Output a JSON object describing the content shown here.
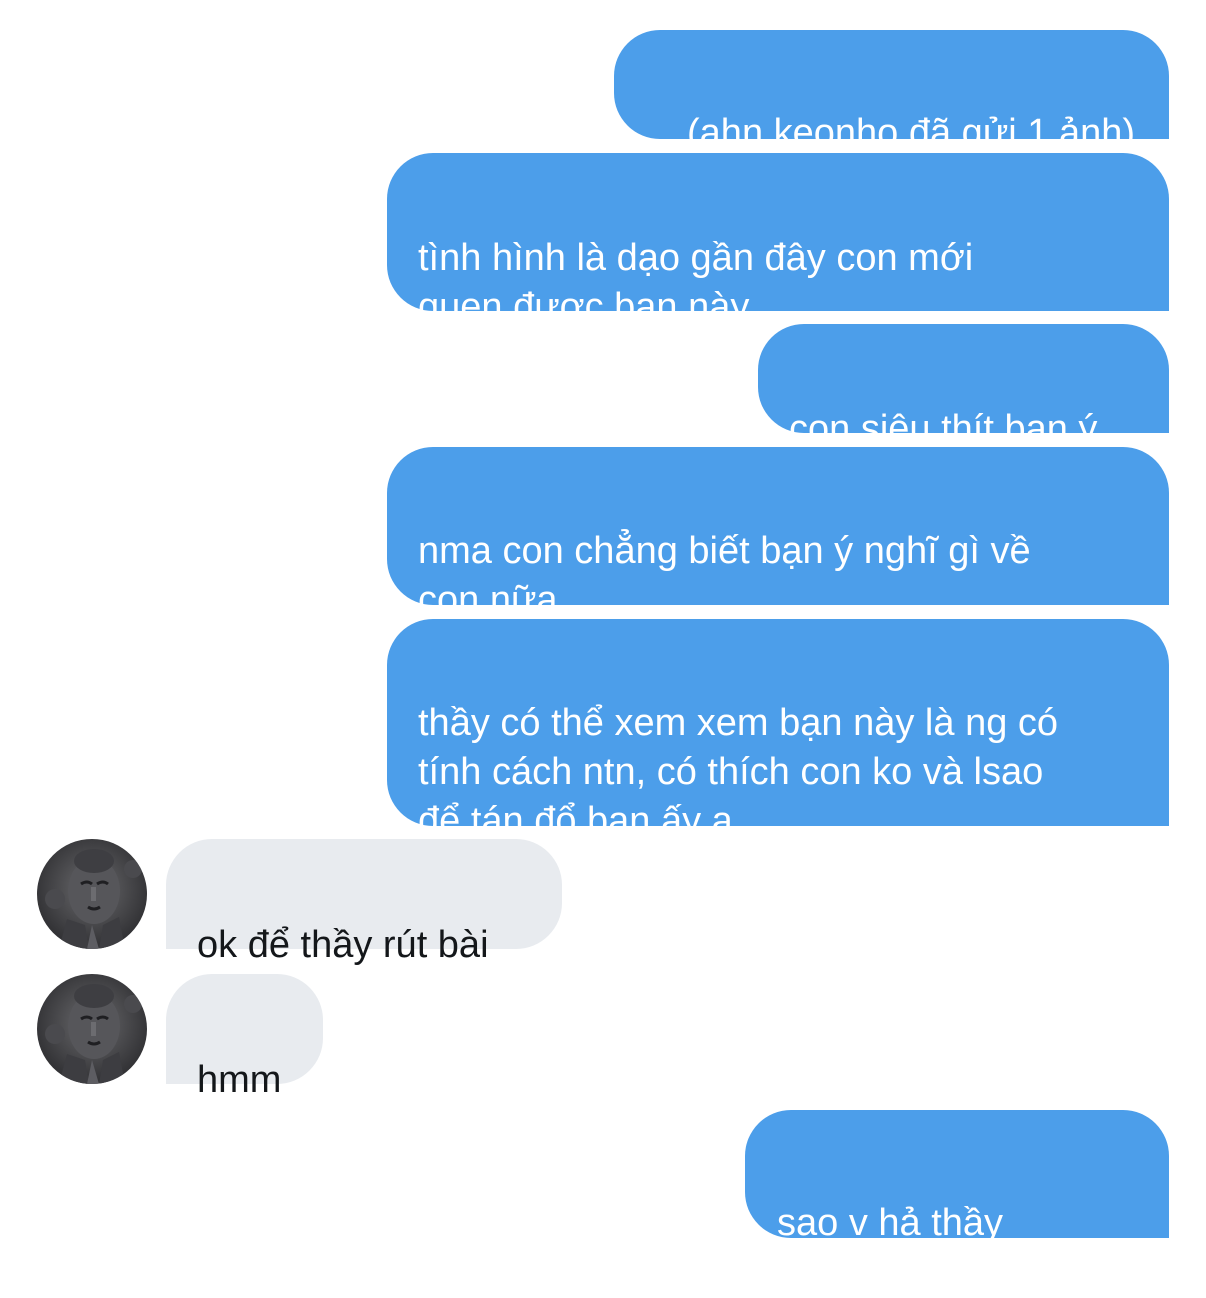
{
  "conversation": {
    "messages": [
      {
        "sender": "me",
        "text": "(ahn keonho đã gửi 1 ảnh)"
      },
      {
        "sender": "me",
        "text": "tình hình là dạo gần đây con mới\nquen được bạn này"
      },
      {
        "sender": "me",
        "text": "con siêu thít bạn ý"
      },
      {
        "sender": "me",
        "text": "nma con chẳng biết bạn ý nghĩ gì về\ncon nữa"
      },
      {
        "sender": "me",
        "text": "thầy có thể xem xem bạn này là ng có\ntính cách ntn, có thích con ko và lsao\nđể tán đổ bạn ấy ạ"
      },
      {
        "sender": "them",
        "text": "ok để thầy rút bài"
      },
      {
        "sender": "them",
        "text": "hmm"
      },
      {
        "sender": "me",
        "text": "sao v hả thầy",
        "emoji": "😥 😥"
      }
    ]
  },
  "colors": {
    "outgoing_bubble": "#4c9eea",
    "incoming_bubble": "#e8ebef",
    "background": "#ffffff"
  },
  "icons": {
    "avatar": "buddha-statue-avatar-icon"
  }
}
